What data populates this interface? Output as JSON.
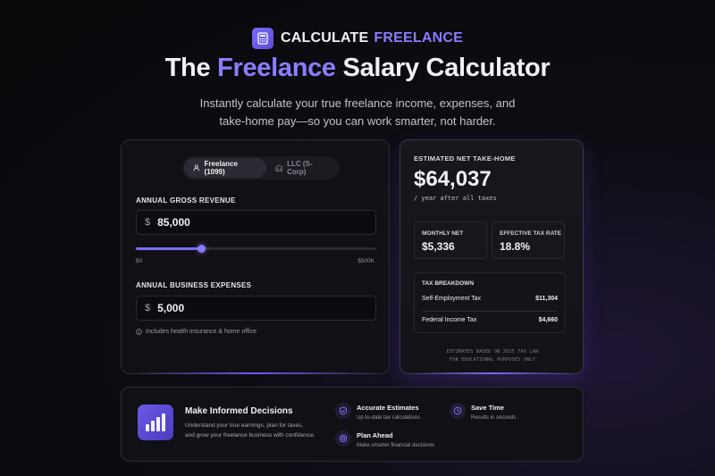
{
  "brand": {
    "name": "CALCULATE",
    "accent": "FREELANCE",
    "icon": "calculator-icon"
  },
  "headline": {
    "pre": "The",
    "accent": "Freelance",
    "post": "Salary Calculator"
  },
  "subline": {
    "line1": "Instantly calculate your true freelance income, expenses, and",
    "line2": "take-home pay—so you can work smarter, not harder."
  },
  "calculator": {
    "tabs": [
      {
        "label": "Freelance (1099)",
        "icon": "person-icon",
        "active": true
      },
      {
        "label": "LLC (S-Corp)",
        "icon": "building-icon",
        "active": false
      }
    ],
    "revenue": {
      "label": "ANNUAL GROSS REVENUE",
      "currency": "$",
      "value": "85,000",
      "slider_fraction": 0.27,
      "min_label": "$0",
      "max_label": "$500K"
    },
    "expenses": {
      "label": "ANNUAL BUSINESS EXPENSES",
      "currency": "$",
      "value": "5,000",
      "hint": "Includes health insurance & home office"
    }
  },
  "results": {
    "label": "ESTIMATED NET TAKE-HOME",
    "value": "$64,037",
    "sub": "/ year after all taxes",
    "monthly": {
      "label": "MONTHLY NET",
      "value": "$5,336"
    },
    "rate": {
      "label": "EFFECTIVE TAX RATE",
      "value": "18.8%"
    },
    "breakdown": {
      "title": "TAX BREAKDOWN",
      "rows": [
        {
          "label": "Self-Employment Tax",
          "amount": "$11,304"
        },
        {
          "label": "Federal Income Tax",
          "amount": "$4,660"
        }
      ]
    },
    "disclaimer1": "ESTIMATES BASED ON 2025 TAX LAW",
    "disclaimer2": "FOR EDUCATIONAL PURPOSES ONLY"
  },
  "info": {
    "title": "Make Informed Decisions",
    "desc1": "Understand your true earnings, plan for taxes,",
    "desc2": "and grow your freelance business with confidence.",
    "features": [
      {
        "title": "Accurate Estimates",
        "desc": "Up-to-date tax calculations",
        "icon": "shield-check-icon"
      },
      {
        "title": "Save Time",
        "desc": "Results in seconds",
        "icon": "clock-icon"
      },
      {
        "title": "Plan Ahead",
        "desc": "Make smarter financial decisions",
        "icon": "target-icon"
      }
    ]
  },
  "colors": {
    "accent": "#8b7bff",
    "background": "#0b0b0f"
  }
}
